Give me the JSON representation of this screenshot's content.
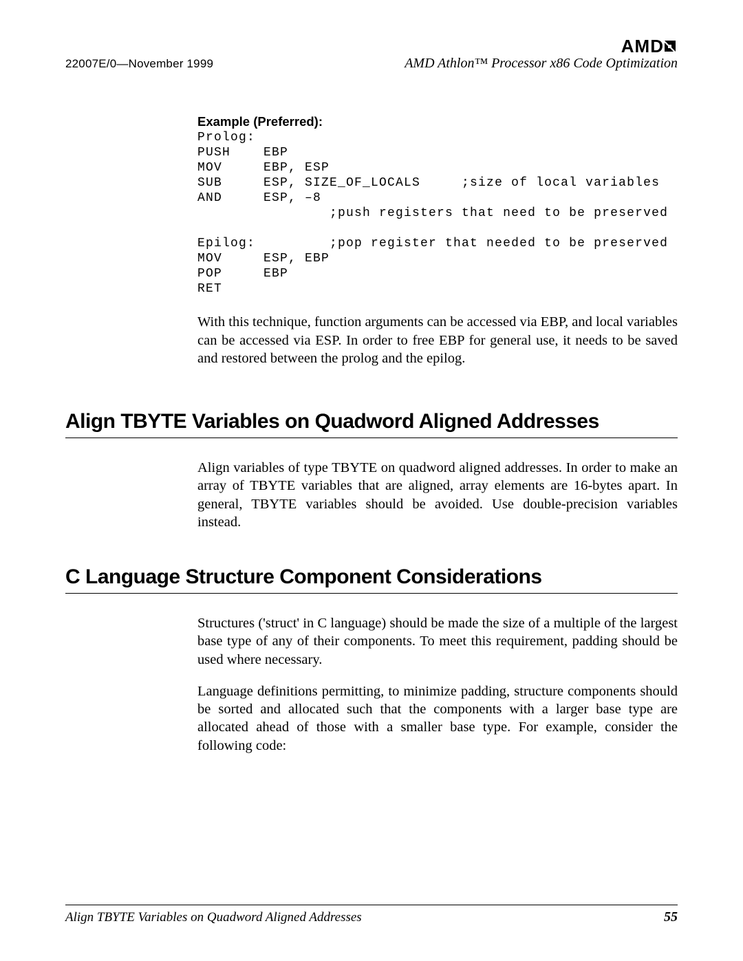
{
  "logo_text": "AMD",
  "header": {
    "doc_id": "22007E/0—November 1999",
    "doc_title": "AMD Athlon™ Processor x86 Code Optimization"
  },
  "example_label": "Example (Preferred):",
  "code": "Prolog:\nPUSH    EBP\nMOV     EBP, ESP\nSUB     ESP, SIZE_OF_LOCALS     ;size of local variables\nAND     ESP, –8\n                ;push registers that need to be preserved\n\nEpilog:         ;pop register that needed to be preserved\nMOV     ESP, EBP\nPOP     EBP\nRET",
  "para1": "With this technique, function arguments can be accessed via EBP, and local variables can be accessed via ESP. In order to free EBP for general use, it needs to be saved and restored between the prolog and the epilog.",
  "heading1": "Align TBYTE Variables on Quadword Aligned Addresses",
  "para2": "Align variables of type TBYTE on quadword aligned addresses. In order to make an array of TBYTE variables that are aligned, array elements are 16-bytes apart. In general, TBYTE variables should be avoided. Use double-precision variables instead.",
  "heading2": "C Language Structure Component Considerations",
  "para3": "Structures ('struct' in C language) should be made the size of a multiple of the largest base type of any of their components. To meet this requirement, padding should be used where necessary.",
  "para4": "Language definitions permitting, to minimize padding, structure components should be sorted and allocated such that the components with a larger base type are allocated ahead of those with a smaller base type. For example, consider the following code:",
  "footer": {
    "title": "Align TBYTE Variables on Quadword Aligned Addresses",
    "page": "55"
  }
}
